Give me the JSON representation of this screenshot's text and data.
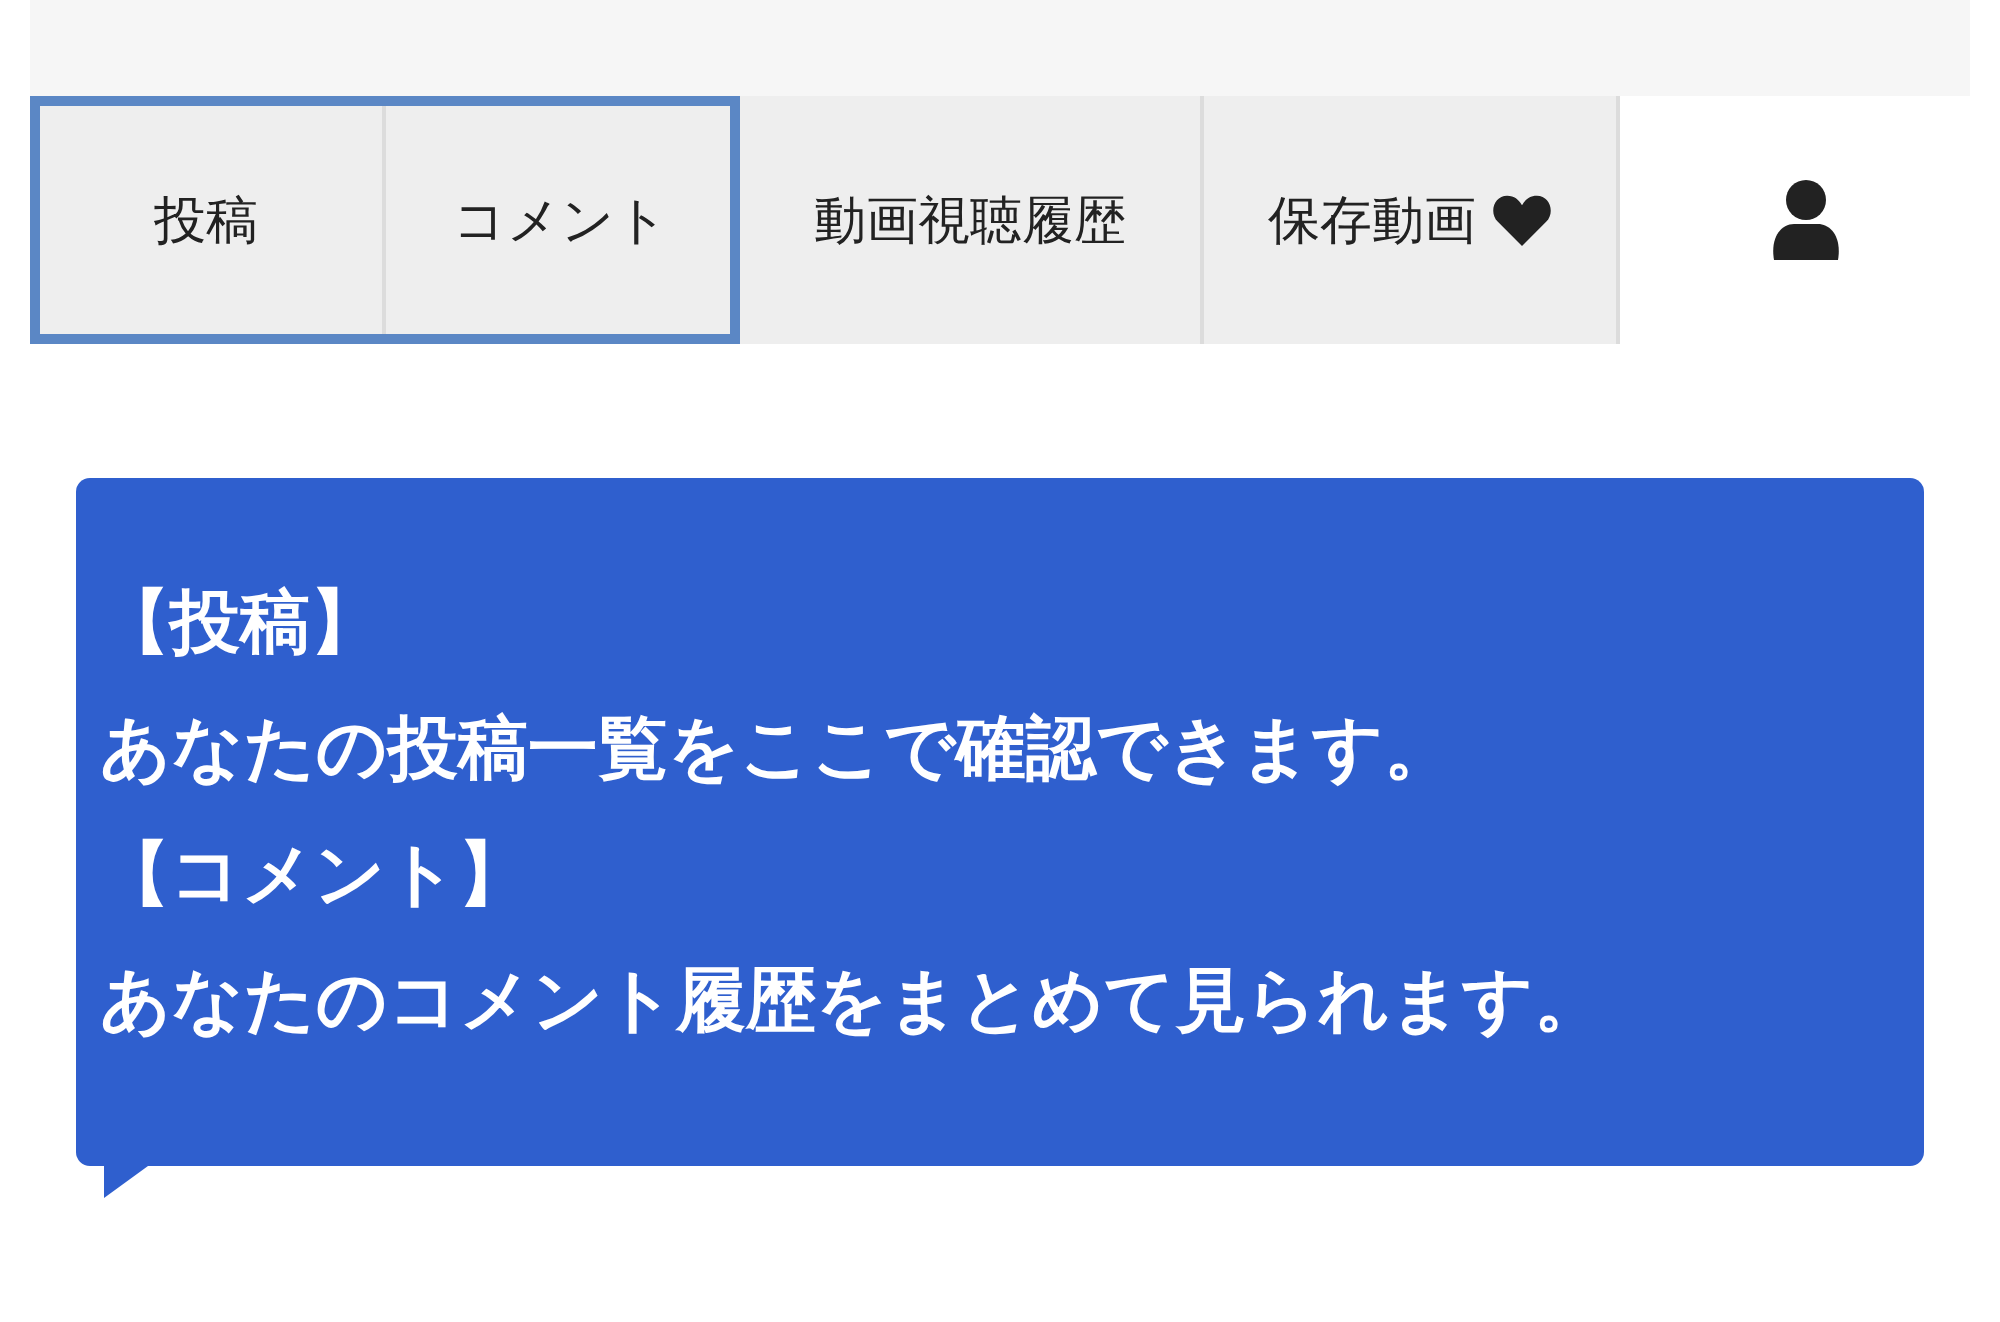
{
  "tabs": [
    {
      "label": "投稿",
      "kind": "plain",
      "highlighted": true
    },
    {
      "label": "コメント",
      "kind": "plain",
      "highlighted": true
    },
    {
      "label": "動画視聴履歴",
      "kind": "plain",
      "highlighted": false
    },
    {
      "label": "保存動画",
      "kind": "saved",
      "highlighted": false
    }
  ],
  "tooltip": {
    "lines": [
      "【投稿】",
      "あなたの投稿一覧をここで確認できます。",
      "【コメント】",
      "あなたのコメント履歴をまとめて見られます。"
    ]
  }
}
